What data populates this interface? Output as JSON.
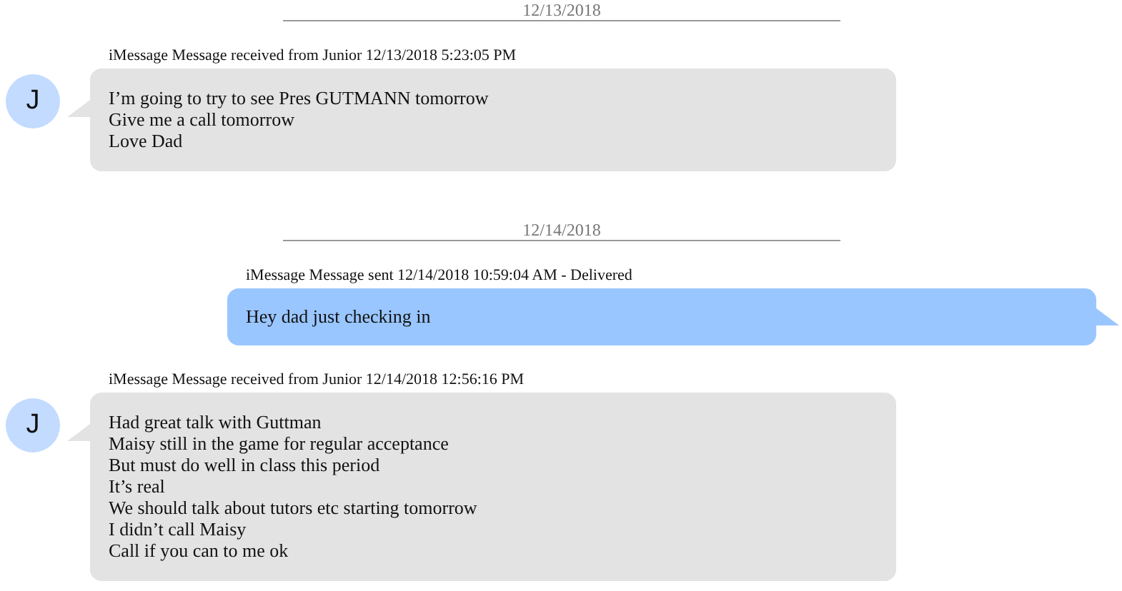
{
  "thread": [
    {
      "kind": "date",
      "text": "12/13/2018"
    },
    {
      "kind": "received",
      "avatar": "J",
      "header": "iMessage Message received from Junior 12/13/2018 5:23:05 PM",
      "lines": [
        "I’m going to try to see Pres GUTMANN tomorrow",
        "Give me a call tomorrow",
        "Love Dad"
      ]
    },
    {
      "kind": "date",
      "text": "12/14/2018"
    },
    {
      "kind": "sent",
      "header": "iMessage Message sent 12/14/2018 10:59:04 AM - Delivered",
      "lines": [
        "Hey dad just checking in"
      ]
    },
    {
      "kind": "received",
      "avatar": "J",
      "header": "iMessage Message received from Junior 12/14/2018 12:56:16 PM",
      "lines": [
        "Had great talk with Guttman",
        "Maisy still in the game for regular acceptance",
        "But must do well in class this period",
        "It’s real",
        "We should talk about tutors etc starting tomorrow",
        "I didn’t call Maisy",
        "Call if you can to me ok"
      ]
    }
  ]
}
